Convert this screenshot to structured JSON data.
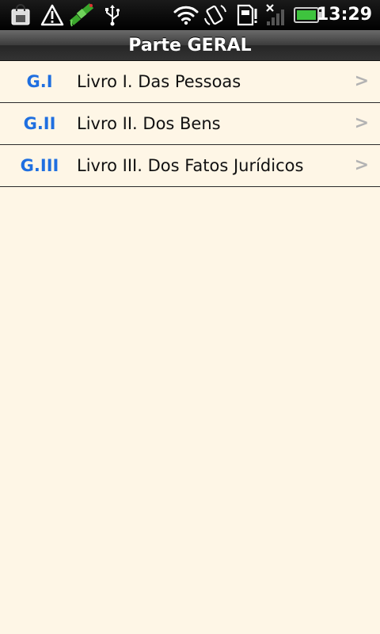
{
  "status_bar": {
    "time": "13:29",
    "icons": [
      "shopping-bag-icon",
      "warning-icon",
      "gps-satellite-icon",
      "usb-icon",
      "wifi-icon",
      "rotate-icon",
      "sd-card-alert-icon",
      "signal-off-icon",
      "battery-icon"
    ],
    "colors": {
      "battery": "#3ec43e",
      "satellite": "#3aa62c"
    }
  },
  "title_bar": {
    "title": "Parte GERAL"
  },
  "list": {
    "items": [
      {
        "code": "G.I",
        "label": "Livro I. Das Pessoas",
        "chevron": ">"
      },
      {
        "code": "G.II",
        "label": "Livro II. Dos Bens",
        "chevron": ">"
      },
      {
        "code": "G.III",
        "label": "Livro III. Dos Fatos Jurídicos",
        "chevron": ">"
      }
    ]
  },
  "colors": {
    "background": "#fef6e6",
    "code_text": "#1f6fe0",
    "chevron": "#b3b3b3"
  }
}
